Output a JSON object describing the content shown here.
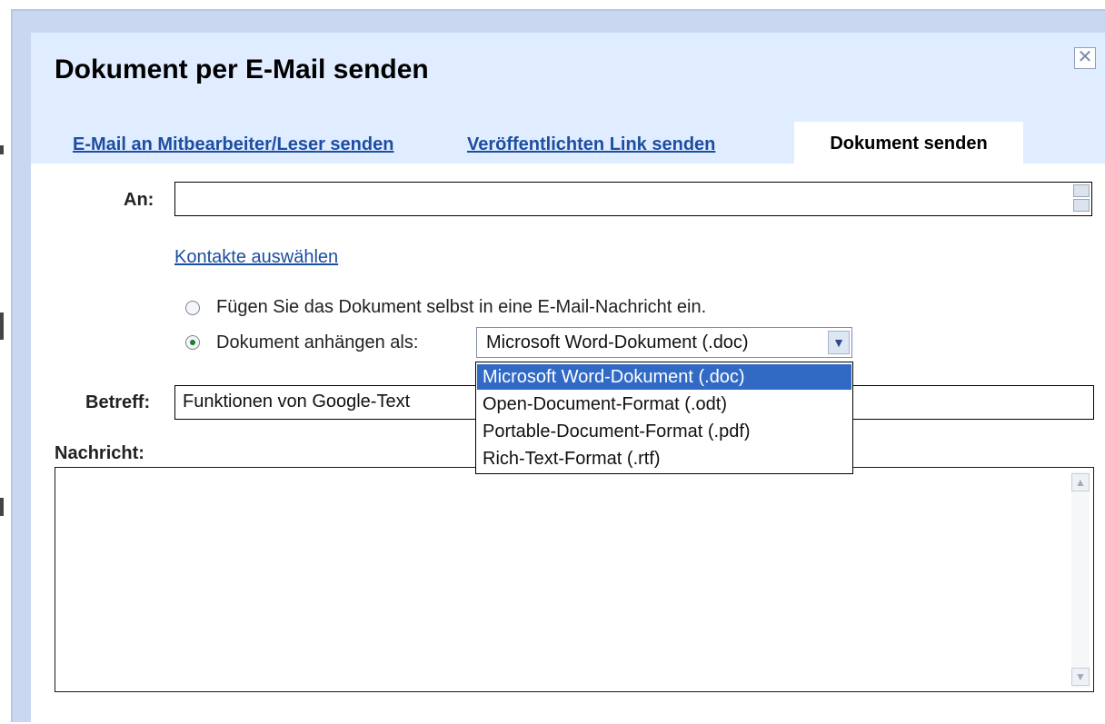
{
  "dialog": {
    "title": "Dokument per E-Mail senden",
    "close_glyph": "✕"
  },
  "tabs": [
    {
      "label": "E-Mail an Mitbearbeiter/Leser senden",
      "active": false
    },
    {
      "label": "Veröffentlichten Link senden",
      "active": false
    },
    {
      "label": "Dokument senden",
      "active": true
    }
  ],
  "form": {
    "to_label": "An:",
    "to_value": "",
    "contacts_link": "Kontakte auswählen",
    "radio_insert_label": "Fügen Sie das Dokument selbst in eine E-Mail-Nachricht ein.",
    "radio_attach_label": "Dokument anhängen als:",
    "format_select": {
      "selected": "Microsoft Word-Dokument (.doc)",
      "options": [
        "Microsoft Word-Dokument (.doc)",
        "Open-Document-Format (.odt)",
        "Portable-Document-Format (.pdf)",
        "Rich-Text-Format (.rtf)"
      ]
    },
    "subject_label": "Betreff:",
    "subject_value": "Funktionen von Google-Text",
    "message_label": "Nachricht:",
    "message_value": ""
  },
  "icons": {
    "close": "close-icon",
    "dropdown": "chevron-down-icon",
    "spinner": "spinner-icon",
    "scroll_up": "scroll-up-icon",
    "scroll_down": "scroll-down-icon"
  },
  "colors": {
    "dialog_border": "#c9d7f1",
    "title_bg": "#e0ecff",
    "link": "#1c4ea1",
    "selection": "#316ac5"
  }
}
